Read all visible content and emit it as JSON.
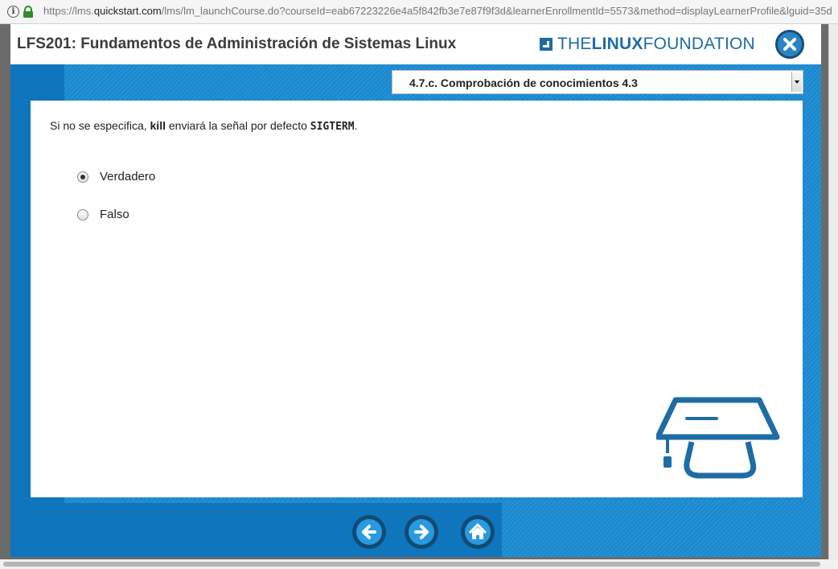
{
  "browser": {
    "url_prefix": "https://lms.",
    "url_domain": "quickstart.com",
    "url_rest": "/lms/lm_launchCourse.do?courseId=eab67223226e4a5f842fb3e7e87f9f3d&learnerEnrollmentId=5573&method=displayLearnerProfile&lguid=35d"
  },
  "header": {
    "course_title": "LFS201: Fundamentos de Administración de Sistemas Linux",
    "logo_the": "THE",
    "logo_linux": "LINUX",
    "logo_foundation": "FOUNDATION",
    "close_icon": "close-icon"
  },
  "page_select": {
    "value": "4.7.c. Comprobación de conocimientos 4.3"
  },
  "question": {
    "prefix": "Si no se especifica, ",
    "keyword": "kill",
    "middle": " enviará la señal por defecto ",
    "code": "SIGTERM",
    "suffix": "."
  },
  "options": [
    {
      "label": "Verdadero",
      "selected": true
    },
    {
      "label": "Falso",
      "selected": false
    }
  ],
  "nav": {
    "back_icon": "arrow-left-icon",
    "next_icon": "arrow-right-icon",
    "home_icon": "home-icon"
  },
  "colors": {
    "brand_blue": "#1f6ca5",
    "background_blue": "#1b86cc",
    "dark_blue": "#0f75bd",
    "nav_button": "#114b73"
  }
}
